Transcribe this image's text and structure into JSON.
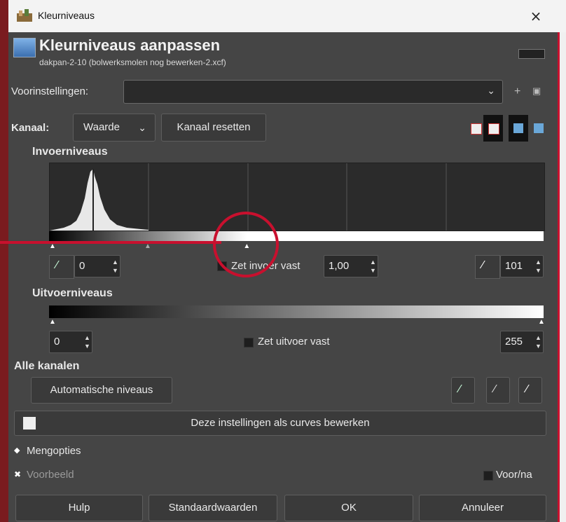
{
  "window": {
    "title": "Kleurniveaus",
    "close_glyph": "×"
  },
  "header": {
    "title": "Kleurniveaus aanpassen",
    "subtitle": "dakpan-2-10 (bolwerksmolen nog bewerken-2.xcf)"
  },
  "presets": {
    "label": "Voorinstellingen:",
    "value": "",
    "add_glyph": "+",
    "menu_glyph": "▣"
  },
  "channel": {
    "label": "Kanaal:",
    "value": "Waarde",
    "reset_label": "Kanaal resetten"
  },
  "input_levels": {
    "heading": "Invoerniveaus",
    "low_value": "0",
    "gamma_label": "Zet invoer vast",
    "gamma_value": "1,00",
    "high_value": "101",
    "gamma_slider_fraction": 0.4
  },
  "output_levels": {
    "heading": "Uitvoerniveaus",
    "low_value": "0",
    "lock_label": "Zet uitvoer vast",
    "high_value": "255"
  },
  "all_channels": {
    "heading": "Alle kanalen",
    "auto_label": "Automatische niveaus"
  },
  "curves_button": {
    "label": "Deze instellingen als curves bewerken"
  },
  "blend": {
    "label": "Mengopties"
  },
  "preview": {
    "label": "Voorbeeld",
    "before_after_label": "Voor/na"
  },
  "footer": {
    "help": "Hulp",
    "defaults": "Standaardwaarden",
    "ok": "OK",
    "cancel": "Annuleer"
  },
  "colors": {
    "annotation": "#c8102e",
    "bg": "#454545"
  }
}
